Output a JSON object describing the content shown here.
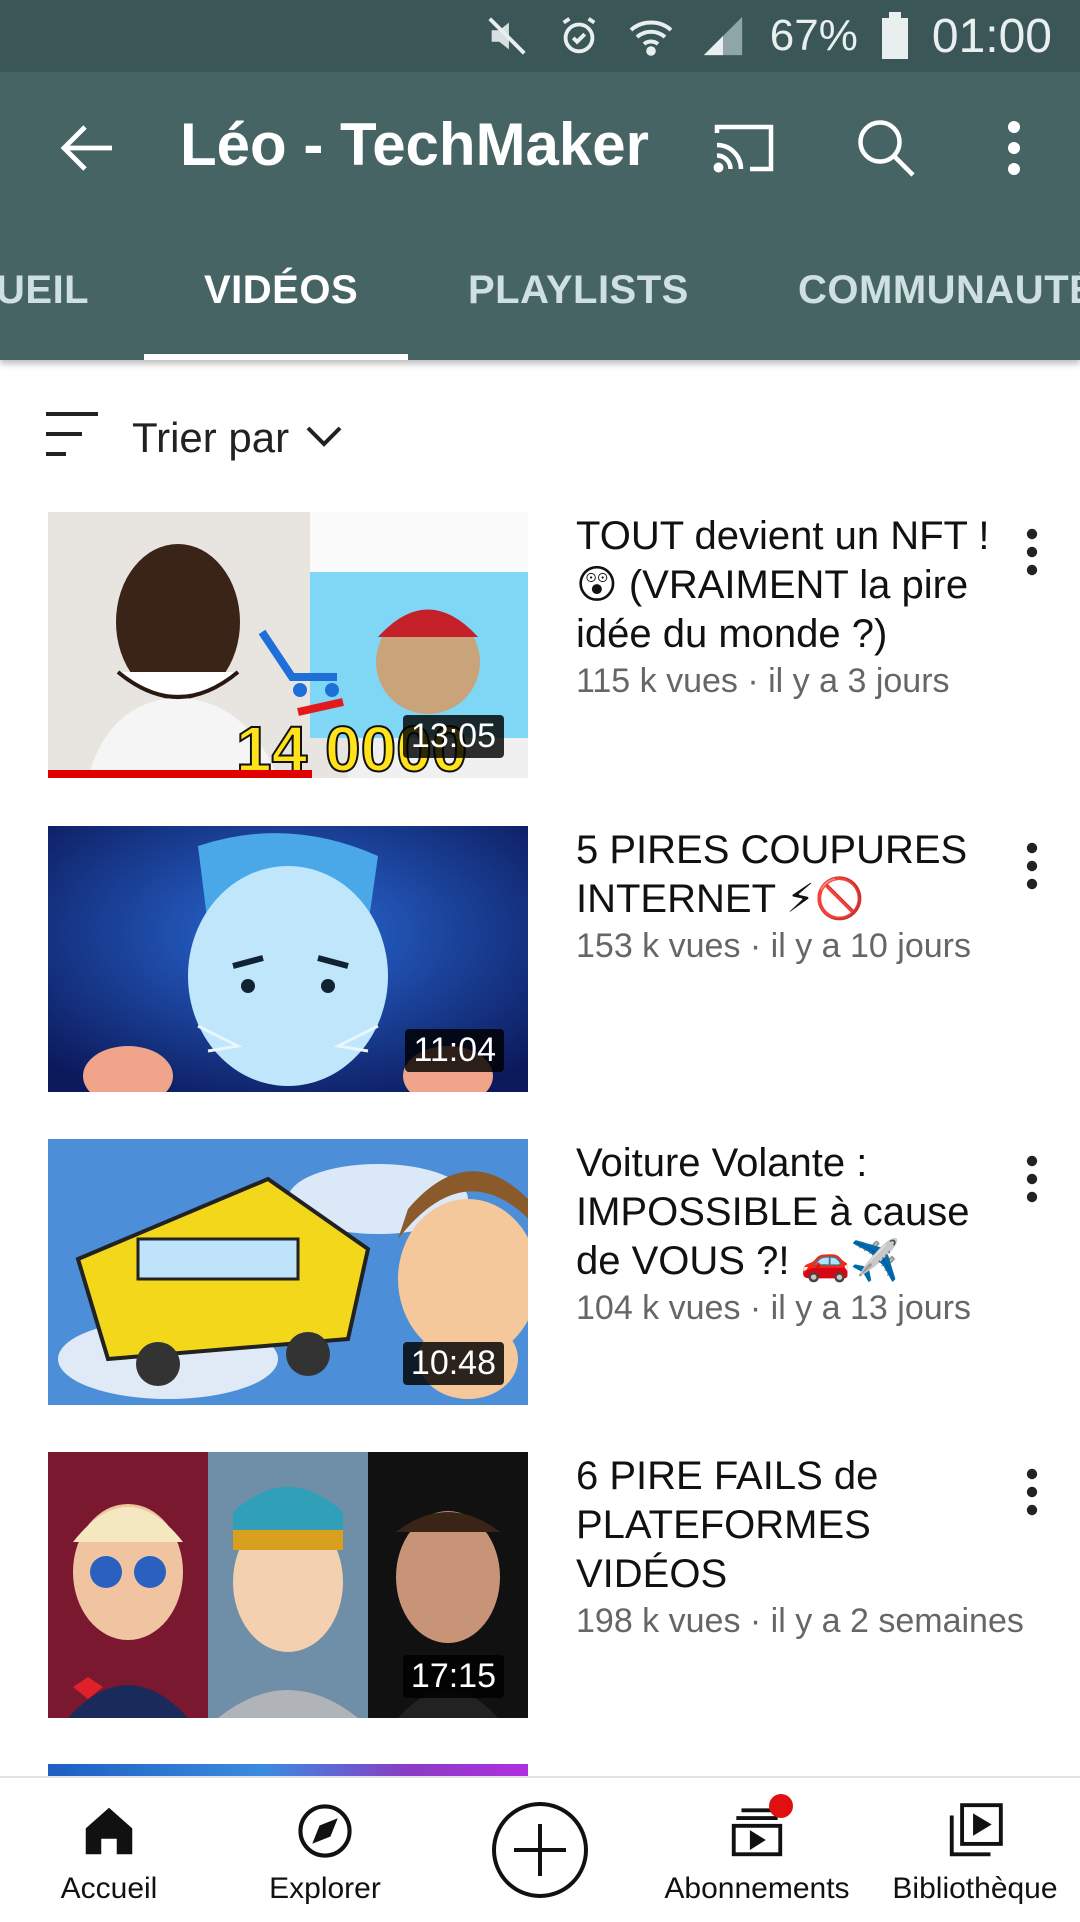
{
  "status": {
    "battery": "67%",
    "time": "01:00",
    "icons": [
      "mute-icon",
      "alarm-icon",
      "wifi-icon",
      "signal-icon",
      "battery-icon"
    ]
  },
  "appbar": {
    "title": "Léo - TechMaker",
    "icons": [
      "back-arrow-icon",
      "cast-icon",
      "search-icon",
      "more-vert-icon"
    ]
  },
  "tabs": [
    {
      "label": "UEIL"
    },
    {
      "label": "VIDÉOS"
    },
    {
      "label": "PLAYLISTS"
    },
    {
      "label": "COMMUNAUTÉ"
    }
  ],
  "active_tab": "VIDÉOS",
  "sort": {
    "label": "Trier par"
  },
  "videos": [
    {
      "title": "TOUT devient un NFT ! 😲 (VRAIMENT la pire idée du monde ?)",
      "meta": "115 k vues · il y a 3 jours",
      "duration": "13:05",
      "thumb_text": "14 0000",
      "watched_progress": 0.55
    },
    {
      "title": "5 PIRES COUPURES INTERNET ⚡🚫",
      "meta": "153 k vues · il y a 10 jours",
      "duration": "11:04"
    },
    {
      "title": "Voiture Volante : IMPOSSIBLE à cause de VOUS ?! 🚗✈️",
      "meta": "104 k vues · il y a 13 jours",
      "duration": "10:48"
    },
    {
      "title": "6 PIRE FAILS de PLATEFORMES VIDÉOS",
      "meta": "198 k vues · il y a 2 semaines",
      "duration": "17:15"
    }
  ],
  "bottom_nav": [
    {
      "label": "Accueil",
      "icon": "home-icon"
    },
    {
      "label": "Explorer",
      "icon": "compass-icon"
    },
    {
      "label": "",
      "icon": "add-circle-icon"
    },
    {
      "label": "Abonnements",
      "icon": "subscriptions-icon"
    },
    {
      "label": "Bibliothèque",
      "icon": "library-icon"
    }
  ],
  "colors": {
    "appbar": "#476464",
    "statusbar": "#3a5656",
    "progress": "#e00000",
    "badge": "#e01010"
  }
}
